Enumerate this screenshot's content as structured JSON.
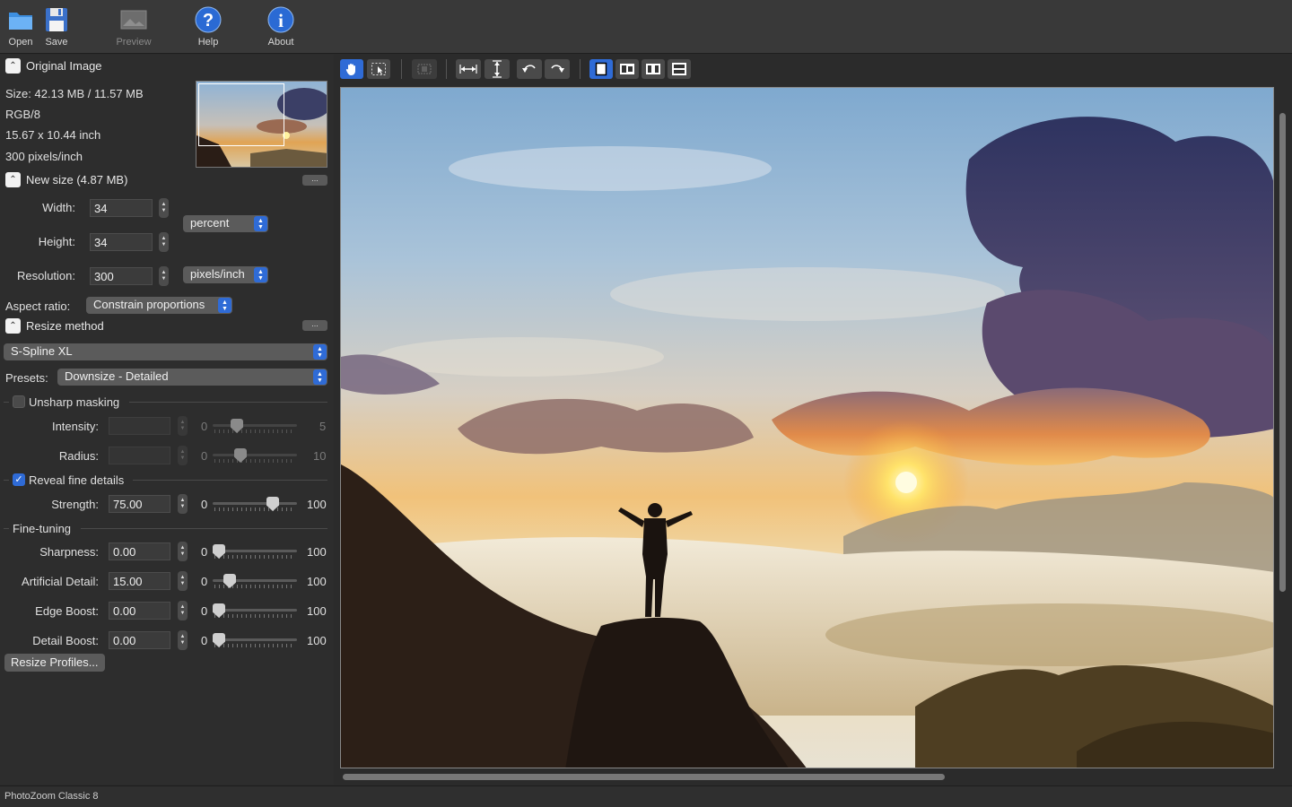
{
  "toolbar": {
    "open": "Open",
    "save": "Save",
    "preview": "Preview",
    "help": "Help",
    "about": "About"
  },
  "original": {
    "title": "Original Image",
    "size": "Size: 42.13 MB / 11.57 MB",
    "mode": "RGB/8",
    "dims": "15.67 x 10.44 inch",
    "res": "300 pixels/inch"
  },
  "newsize": {
    "title": "New size (4.87 MB)",
    "more": "...",
    "width_label": "Width:",
    "width_value": "34",
    "height_label": "Height:",
    "height_value": "34",
    "unit": "percent",
    "res_label": "Resolution:",
    "res_value": "300",
    "res_unit": "pixels/inch",
    "aspect_label": "Aspect ratio:",
    "aspect_value": "Constrain proportions"
  },
  "method": {
    "title": "Resize method",
    "more": "...",
    "algorithm": "S-Spline XL",
    "presets_label": "Presets:",
    "preset": "Downsize - Detailed"
  },
  "unsharp": {
    "title": "Unsharp masking",
    "checked": false,
    "intensity_label": "Intensity:",
    "intensity_min": "0",
    "intensity_max": "5",
    "intensity_level": 0.25,
    "radius_label": "Radius:",
    "radius_min": "0",
    "radius_max": "10",
    "radius_level": 0.3
  },
  "reveal": {
    "title": "Reveal fine details",
    "checked": true,
    "strength_label": "Strength:",
    "strength_value": "75.00",
    "min": "0",
    "max": "100",
    "level": 0.75
  },
  "finetune": {
    "title": "Fine-tuning",
    "rows": [
      {
        "label": "Sharpness:",
        "value": "0.00",
        "min": "0",
        "max": "100",
        "level": 0.0
      },
      {
        "label": "Artificial Detail:",
        "value": "15.00",
        "min": "0",
        "max": "100",
        "level": 0.15
      },
      {
        "label": "Edge Boost:",
        "value": "0.00",
        "min": "0",
        "max": "100",
        "level": 0.0
      },
      {
        "label": "Detail Boost:",
        "value": "0.00",
        "min": "0",
        "max": "100",
        "level": 0.0
      }
    ]
  },
  "profiles_button": "Resize Profiles...",
  "status": "PhotoZoom Classic 8",
  "colors": {
    "accent": "#2f6bd6",
    "panel": "#2d2d2d",
    "toolbar": "#393939"
  }
}
